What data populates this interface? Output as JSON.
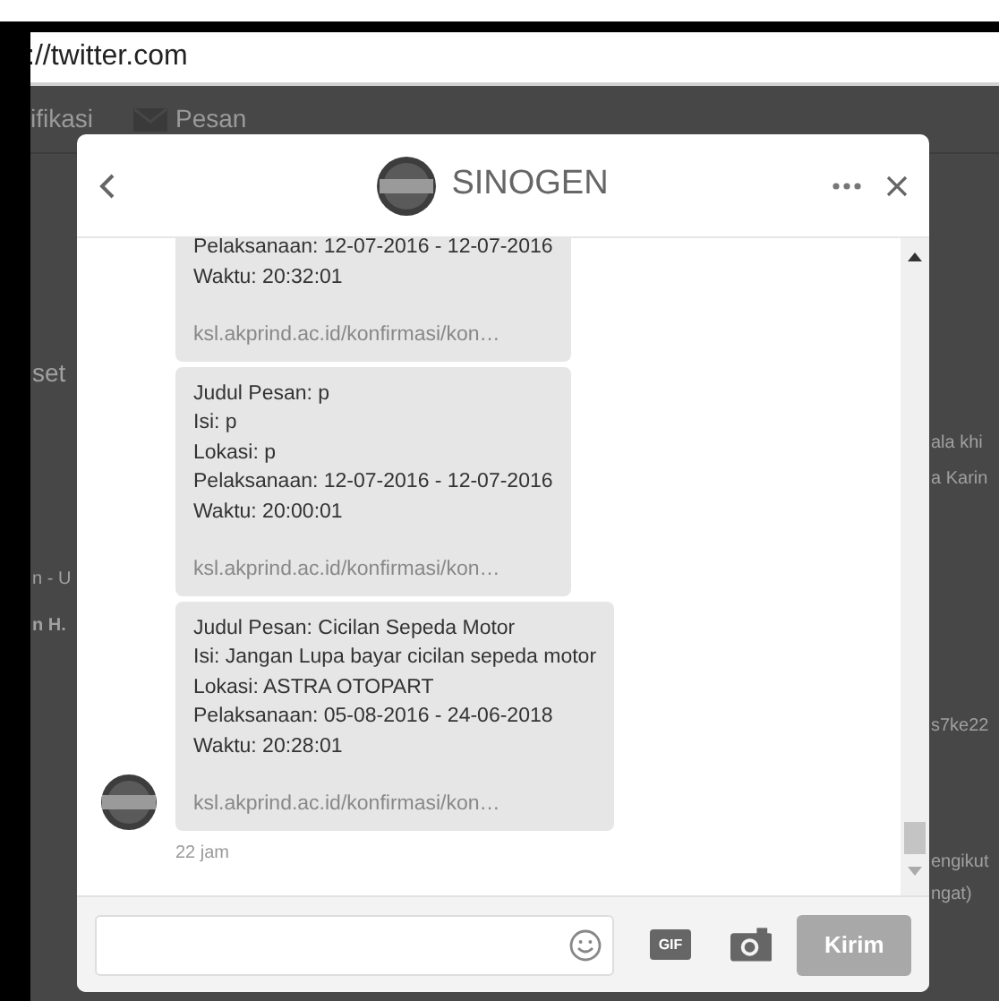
{
  "browser": {
    "address": "://twitter.com"
  },
  "background": {
    "nav_items": [
      "ifikasi",
      "Pesan"
    ],
    "left_texts": [
      "set",
      "n - U",
      "n H."
    ],
    "right_texts": [
      "ala khi",
      "a Karin",
      "s7ke22",
      "engikut",
      "ngat)"
    ]
  },
  "dialog": {
    "title": "SINOGEN",
    "messages": [
      {
        "lines": [
          "Pelaksanaan: 12-07-2016 - 12-07-2016",
          "Waktu: 20:32:01"
        ],
        "link": "ksl.akprind.ac.id/konfirmasi/kon…"
      },
      {
        "lines": [
          "Judul Pesan: p",
          "Isi: p",
          "Lokasi: p",
          "Pelaksanaan: 12-07-2016 - 12-07-2016",
          "Waktu: 20:00:01"
        ],
        "link": "ksl.akprind.ac.id/konfirmasi/kon…"
      },
      {
        "lines": [
          "Judul Pesan: Cicilan Sepeda Motor",
          "Isi: Jangan Lupa bayar cicilan sepeda motor",
          "Lokasi: ASTRA OTOPART",
          "Pelaksanaan: 05-08-2016 - 24-06-2018",
          "Waktu: 20:28:01"
        ],
        "link": "ksl.akprind.ac.id/konfirmasi/kon…"
      }
    ],
    "time": "22 jam",
    "composer": {
      "gif_label": "GIF",
      "send": {
        "label": "Kirim",
        "disabled": true
      }
    }
  }
}
